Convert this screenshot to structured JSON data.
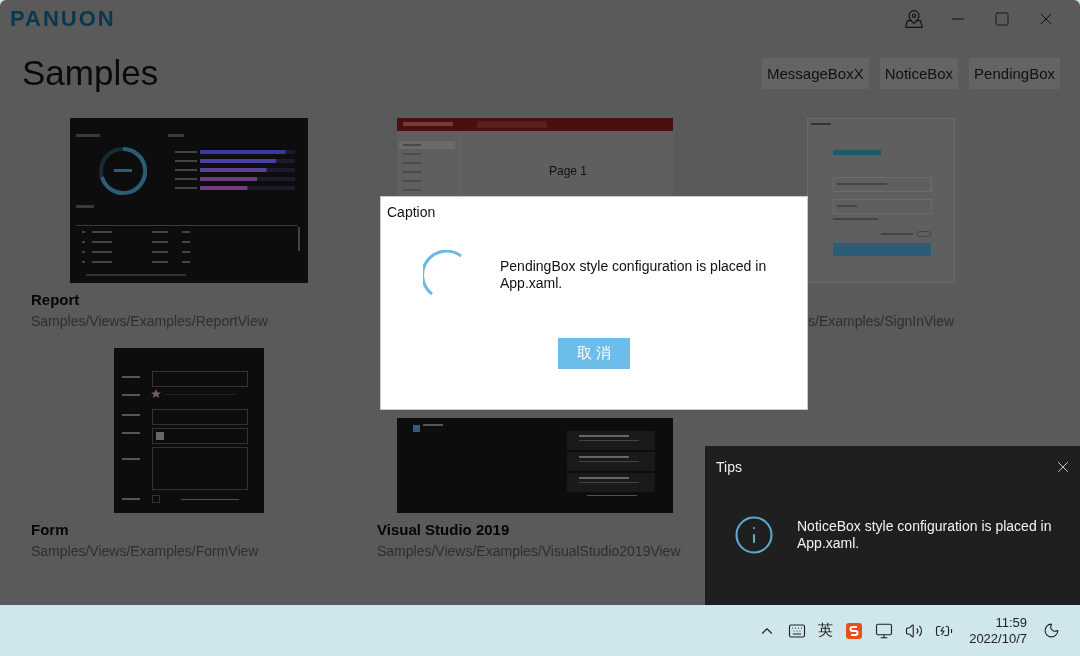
{
  "window": {
    "logo": "PANUON",
    "title": "Samples"
  },
  "toolbar_buttons": [
    "MessageBoxX",
    "NoticeBox",
    "PendingBox"
  ],
  "samples": [
    {
      "kind": "report",
      "title": "Report",
      "path": "Samples/Views/Examples/ReportView"
    },
    {
      "kind": "music",
      "page": "Page 1"
    },
    {
      "kind": "signin",
      "path": "s/Examples/SignInView",
      "partial": true
    },
    {
      "kind": "form",
      "title": "Form",
      "path": "Samples/Views/Examples/FormView"
    },
    {
      "kind": "vs",
      "title": "Visual Studio 2019",
      "path": "Samples/Views/Examples/VisualStudio2019View"
    }
  ],
  "pending_box": {
    "caption": "Caption",
    "message": "PendingBox style configuration is placed in App.xaml.",
    "button": "取 消"
  },
  "notice_box": {
    "title": "Tips",
    "message": "NoticeBox style configuration is placed in App.xaml."
  },
  "taskbar": {
    "ime": "英",
    "time": "11:59",
    "date": "2022/10/7"
  }
}
